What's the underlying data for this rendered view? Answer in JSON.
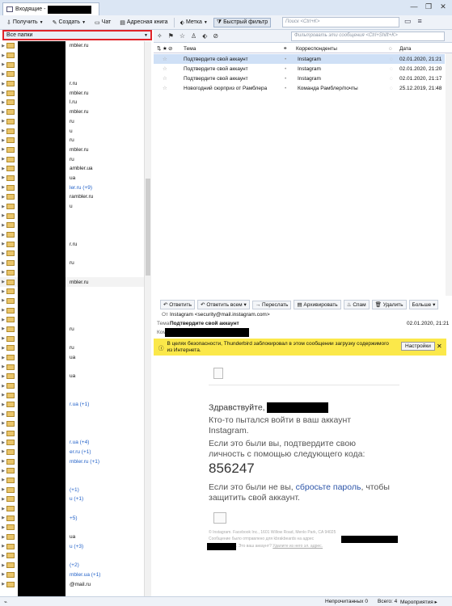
{
  "window": {
    "tab_title": "Входящие -"
  },
  "toolbar": {
    "get": "Получить",
    "write": "Создать",
    "chat": "Чат",
    "addressbook": "Адресная книга",
    "tag": "Метка",
    "quickfilter": "Быстрый фильтр",
    "search_placeholder": "Поиск <Ctrl+K>"
  },
  "folders": {
    "header": "Все папки",
    "rows": [
      {
        "text": "mbler.ru",
        "blue": false
      },
      {
        "text": "",
        "blue": false
      },
      {
        "text": "",
        "blue": false
      },
      {
        "text": "",
        "blue": false
      },
      {
        "text": "r.ru",
        "blue": false
      },
      {
        "text": "mbler.ru",
        "blue": false
      },
      {
        "text": "l.ru",
        "blue": false
      },
      {
        "text": "mbler.ru",
        "blue": false
      },
      {
        "text": "ru",
        "blue": false
      },
      {
        "text": "u",
        "blue": false
      },
      {
        "text": "ru",
        "blue": false
      },
      {
        "text": "mbler.ru",
        "blue": false
      },
      {
        "text": "ru",
        "blue": false
      },
      {
        "text": "ambler.ua",
        "blue": false
      },
      {
        "text": "ua",
        "blue": false
      },
      {
        "text": "ler.ru (+9)",
        "blue": true
      },
      {
        "text": "rambler.ru",
        "blue": false
      },
      {
        "text": "u",
        "blue": false
      },
      {
        "text": "",
        "blue": false
      },
      {
        "text": "",
        "blue": false
      },
      {
        "text": "",
        "blue": false
      },
      {
        "text": "r.ru",
        "blue": false
      },
      {
        "text": "",
        "blue": false
      },
      {
        "text": "ru",
        "blue": false
      },
      {
        "text": "",
        "blue": false
      },
      {
        "text": "mbler.ru",
        "blue": false
      },
      {
        "text": "",
        "blue": false
      },
      {
        "text": "",
        "blue": false
      },
      {
        "text": "",
        "blue": false
      },
      {
        "text": "",
        "blue": false
      },
      {
        "text": "ru",
        "blue": false
      },
      {
        "text": "",
        "blue": false
      },
      {
        "text": "ru",
        "blue": false
      },
      {
        "text": "ua",
        "blue": false
      },
      {
        "text": "",
        "blue": false
      },
      {
        "text": "ua",
        "blue": false
      },
      {
        "text": "",
        "blue": false
      },
      {
        "text": "",
        "blue": false
      },
      {
        "text": "r.ua (+1)",
        "blue": true
      },
      {
        "text": "",
        "blue": false
      },
      {
        "text": "",
        "blue": false
      },
      {
        "text": "",
        "blue": false
      },
      {
        "text": "r.ua (+4)",
        "blue": true
      },
      {
        "text": "er.ru (+1)",
        "blue": true
      },
      {
        "text": "mbler.ru (+1)",
        "blue": true
      },
      {
        "text": "",
        "blue": false
      },
      {
        "text": "",
        "blue": false
      },
      {
        "text": "(+1)",
        "blue": true
      },
      {
        "text": "u (+1)",
        "blue": true
      },
      {
        "text": "",
        "blue": false
      },
      {
        "text": "+5)",
        "blue": true
      },
      {
        "text": "",
        "blue": false
      },
      {
        "text": "ua",
        "blue": false
      },
      {
        "text": "u (+3)",
        "blue": true
      },
      {
        "text": "",
        "blue": false
      },
      {
        "text": "(+2)",
        "blue": true
      },
      {
        "text": "mbler.ua (+1)",
        "blue": true
      },
      {
        "text": "@mail.ru",
        "blue": false
      }
    ]
  },
  "quickfilter_search": "Фильтровать эти сообщения <Ctrl+Shift+K>",
  "columns": {
    "subject": "Тема",
    "correspondents": "Корреспонденты",
    "date": "Дата"
  },
  "messages": [
    {
      "subject": "Подтвердите свой аккаунт",
      "from": "Instagram",
      "date": "02.01.2020, 21:21",
      "selected": true
    },
    {
      "subject": "Подтвердите свой аккаунт",
      "from": "Instagram",
      "date": "02.01.2020, 21:20",
      "selected": false
    },
    {
      "subject": "Подтвердите свой аккаунт",
      "from": "Instagram",
      "date": "02.01.2020, 21:17",
      "selected": false
    },
    {
      "subject": "Новогодний сюрприз от Рамблера",
      "from": "Команда Рамблер/почты",
      "date": "25.12.2019, 21:48",
      "selected": false
    }
  ],
  "msgtoolbar": {
    "reply": "Ответить",
    "replyall": "Ответить всем",
    "forward": "Переслать",
    "archive": "Архивировать",
    "spam": "Спам",
    "delete": "Удалить",
    "more": "Больше"
  },
  "header": {
    "from_label": "От",
    "from_value": "Instagram <security@mail.instagram.com>",
    "subject_label": "Тема",
    "subject_value": "Подтвердите свой аккаунт",
    "date": "02.01.2020, 21:21",
    "to_label": "Ком"
  },
  "notice": {
    "text1": "В целях безопасности, Thunderbird заблокировал в этом сообщении загрузку содержимого",
    "text2": "из Интернета.",
    "button": "Настройки"
  },
  "mail": {
    "greeting": "Здравствуйте,",
    "line1": "Кто-то пытался войти в ваш аккаунт",
    "line2": "Instagram.",
    "line3": "Если это были вы, подтвердите свою",
    "line4": "личность с помощью следующего кода:",
    "code": "856247",
    "line5a": "Если это были не вы, ",
    "reset_link": "сбросьте пароль",
    "line5b": ", чтобы",
    "line6": "защитить свой аккаунт.",
    "footer1": "© Instagram. Facebook Inc., 1601 Willow Road, Menlo Park, CA 94025",
    "footer2": "Сообщение было отправлено для kbrakbeards на адрес",
    "footer3": ". Это ваш аккаунт?",
    "footer_link": "Удалите из него эл. адрес."
  },
  "status": {
    "unread": "Непрочитанных 0",
    "total": "Всего: 4",
    "events": "Мероприятия"
  }
}
